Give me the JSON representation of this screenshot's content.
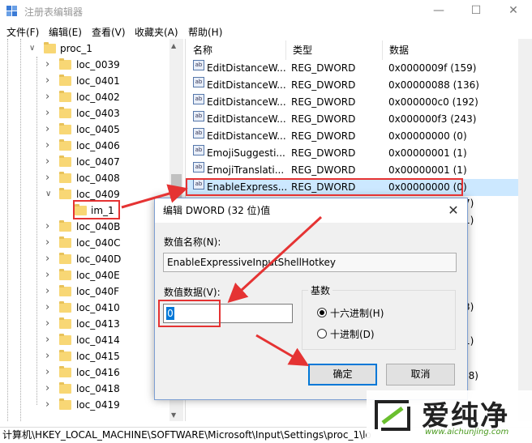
{
  "window": {
    "title": "注册表编辑器",
    "controls": [
      "—",
      "☐",
      "✕"
    ]
  },
  "menu": [
    "文件(F)",
    "编辑(E)",
    "查看(V)",
    "收藏夹(A)",
    "帮助(H)"
  ],
  "tree": {
    "parent": "proc_1",
    "items": [
      "loc_0039",
      "loc_0401",
      "loc_0402",
      "loc_0403",
      "loc_0405",
      "loc_0406",
      "loc_0407",
      "loc_0408",
      "loc_0409",
      "im_1",
      "loc_040B",
      "loc_040C",
      "loc_040D",
      "loc_040E",
      "loc_040F",
      "loc_0410",
      "loc_0413",
      "loc_0414",
      "loc_0415",
      "loc_0416",
      "loc_0418",
      "loc_0419"
    ]
  },
  "list": {
    "headers": [
      "名称",
      "类型",
      "数据"
    ],
    "rows": [
      {
        "name": "EditDistanceW...",
        "type": "REG_DWORD",
        "data": "0x0000009f (159)"
      },
      {
        "name": "EditDistanceW...",
        "type": "REG_DWORD",
        "data": "0x00000088 (136)"
      },
      {
        "name": "EditDistanceW...",
        "type": "REG_DWORD",
        "data": "0x000000c0 (192)"
      },
      {
        "name": "EditDistanceW...",
        "type": "REG_DWORD",
        "data": "0x000000f3 (243)"
      },
      {
        "name": "EditDistanceW...",
        "type": "REG_DWORD",
        "data": "0x00000000 (0)"
      },
      {
        "name": "EmojiSuggesti...",
        "type": "REG_DWORD",
        "data": "0x00000001 (1)"
      },
      {
        "name": "EmojiTranslati...",
        "type": "REG_DWORD",
        "data": "0x00000001 (1)"
      },
      {
        "name": "EnableExpress...",
        "type": "REG_DWORD",
        "data": "0x00000000 (0)"
      }
    ],
    "partial_right": [
      "7)",
      "1)",
      "3)",
      "1)",
      "38)"
    ],
    "icon_text": "ab"
  },
  "dialog": {
    "title": "编辑 DWORD (32 位)值",
    "close": "✕",
    "name_label": "数值名称(N):",
    "name_value": "EnableExpressiveInputShellHotkey",
    "data_label": "数值数据(V):",
    "data_value": "0",
    "base_label": "基数",
    "radix_hex": "十六进制(H)",
    "radix_dec": "十进制(D)",
    "ok": "确定",
    "cancel": "取消"
  },
  "status": "计算机\\HKEY_LOCAL_MACHINE\\SOFTWARE\\Microsoft\\Input\\Settings\\proc_1\\lo",
  "watermark": {
    "brand": "爱纯净",
    "url": "www.aichunjing.com"
  },
  "colors": {
    "selection": "#cce8ff",
    "accent": "#0078d7",
    "annotation": "#e53333",
    "folder": "#f8d775"
  }
}
